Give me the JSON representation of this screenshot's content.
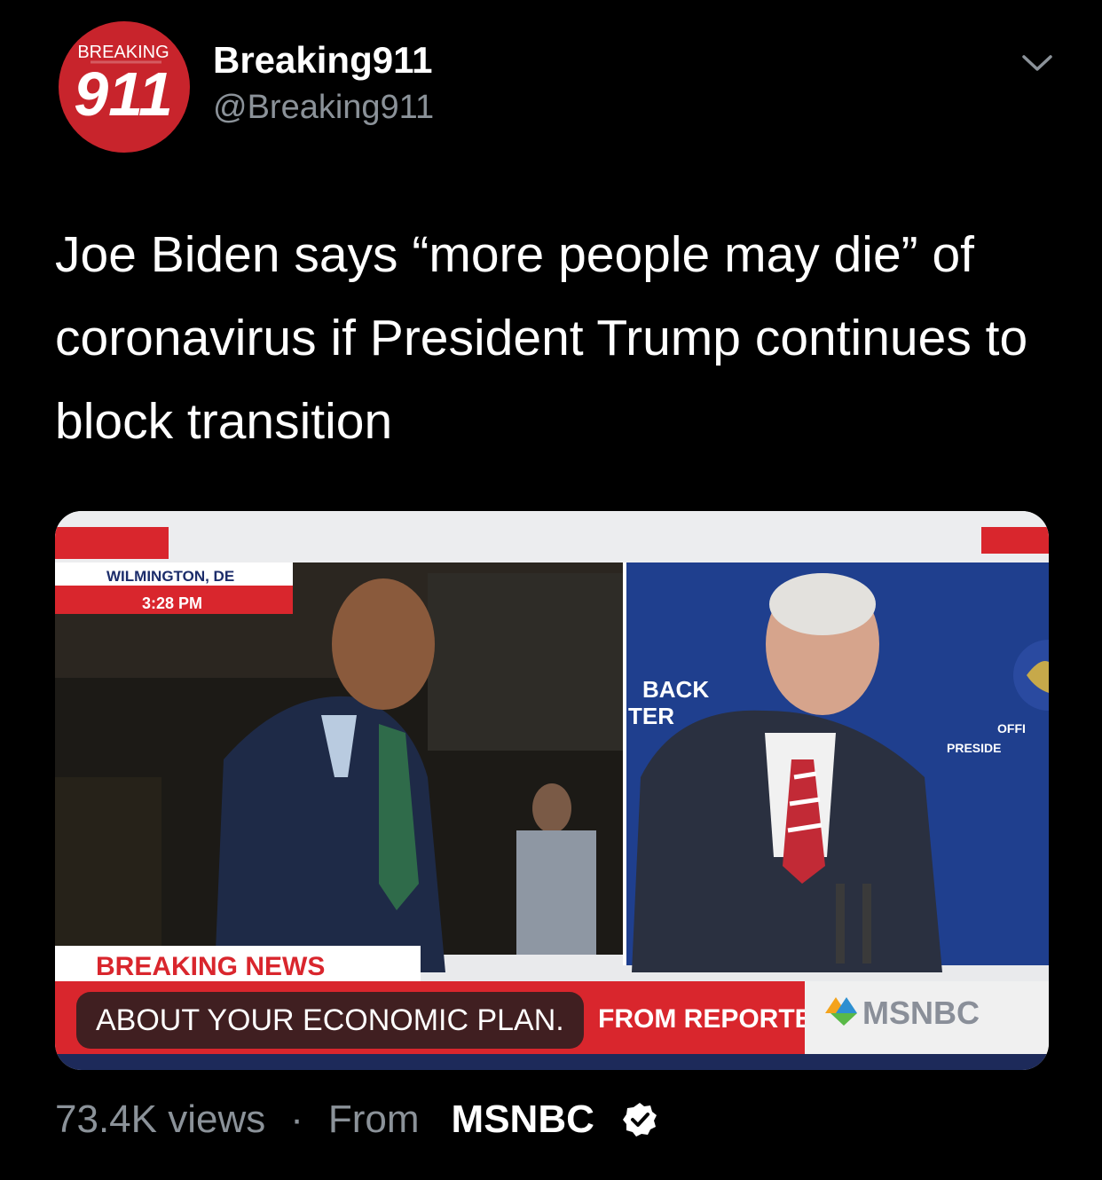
{
  "tweet": {
    "avatar": {
      "text_top": "BREAKING",
      "text_num": "911",
      "icon": "breaking911-logo"
    },
    "display_name": "Breaking911",
    "handle": "@Breaking911",
    "menu_icon": "chevron-down-icon",
    "text": "Joe Biden says “more people may die” of coronavirus if President Trump continues to block transition"
  },
  "video": {
    "location": "WILMINGTON, DE",
    "time": "3:28 PM",
    "backdrop_text_1": "BACK",
    "backdrop_text_2": "TER",
    "seal_text_1": "OFFI",
    "seal_text_2": "PRESIDE",
    "breaking_label": "BREAKING NEWS",
    "ticker_text": "FROM REPORTERS",
    "network_logo": "MSNBC",
    "caption": "ABOUT YOUR ECONOMIC PLAN."
  },
  "footer": {
    "views": "73.4K views",
    "separator": "·",
    "from_label": "From",
    "source": "MSNBC",
    "verified_icon": "verified-badge-icon"
  },
  "colors": {
    "background": "#000000",
    "secondary_text": "#8b9299",
    "avatar_red": "#c8242c",
    "news_red": "#e2252c"
  }
}
